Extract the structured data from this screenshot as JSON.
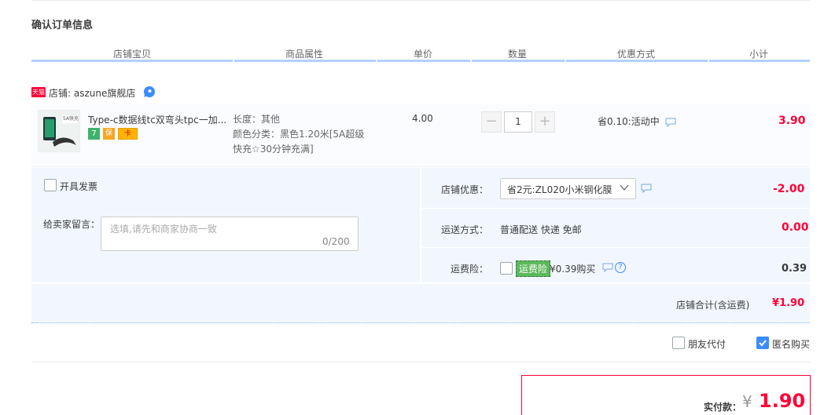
{
  "page": {
    "title": "确认订单信息"
  },
  "columns": [
    "店铺宝贝",
    "商品属性",
    "单价",
    "数量",
    "优惠方式",
    "小计"
  ],
  "shop": {
    "badge": "天猫",
    "name": "店铺: aszune旗舰店"
  },
  "item": {
    "title": "Type-c数据线tc双弯头tpc一加...",
    "attr_length": "长度：其他",
    "attr_color_1": "颜色分类：黑色1.20米[5A超级",
    "attr_color_2": "快充☆30分钟充满]",
    "price": "4.00",
    "quantity": "1",
    "promo": "省0.10:活动中",
    "subtotal": "3.90",
    "thumb_text": "5A快充",
    "service_icons": [
      "7",
      "保",
      "卡"
    ]
  },
  "options": {
    "invoice_label": "开具发票",
    "message_label": "给卖家留言：",
    "message_placeholder": "选填,请先和商家协商一致",
    "message_counter": "0/200",
    "coupon_label": "店铺优惠：",
    "coupon_value": "省2元:ZL020小米钢化膜",
    "coupon_amount": "-2.00",
    "shipping_label": "运送方式：",
    "shipping_value": "普通配送 快递 免邮",
    "shipping_amount": "0.00",
    "insurance_label": "运费险：",
    "insurance_badge": "运费险",
    "insurance_value": "¥0.39购买",
    "insurance_amount": "0.39"
  },
  "shop_total": {
    "label": "店铺合计(含运费)",
    "amount": "¥1.90"
  },
  "extra": {
    "friend_pay": "朋友代付",
    "anonymous": "匿名购买",
    "anonymous_checked": true
  },
  "payment": {
    "label": "实付款：",
    "currency": "¥",
    "amount": "1.90"
  },
  "colors": {
    "accent": "#ff0036",
    "panel": "#f2f7ff",
    "blue": "#3b8cff"
  }
}
